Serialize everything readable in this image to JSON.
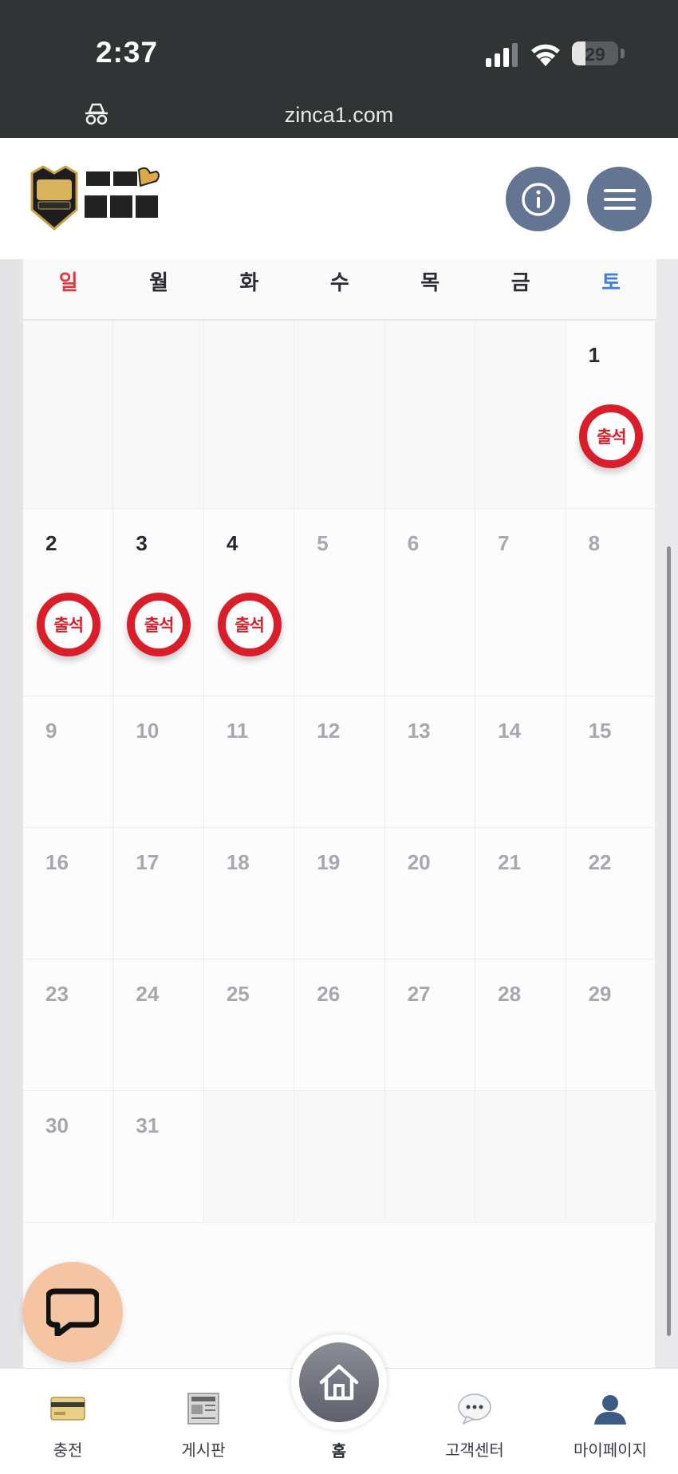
{
  "status_bar": {
    "time": "2:37",
    "battery": "29",
    "battery_level": 0.29
  },
  "browser": {
    "url": "zinca1.com"
  },
  "header": {
    "info_icon": "info-icon",
    "menu_icon": "hamburger-menu-icon",
    "logo_icon": "casino-logo"
  },
  "calendar": {
    "weekdays": [
      "일",
      "월",
      "화",
      "수",
      "목",
      "금",
      "토"
    ],
    "days": [
      "1",
      "2",
      "3",
      "4",
      "5",
      "6",
      "7",
      "8",
      "9",
      "10",
      "11",
      "12",
      "13",
      "14",
      "15",
      "16",
      "17",
      "18",
      "19",
      "20",
      "21",
      "22",
      "23",
      "24",
      "25",
      "26",
      "27",
      "28",
      "29",
      "30",
      "31"
    ],
    "attended": [
      "1",
      "2",
      "3",
      "4"
    ],
    "stamp_label": "출석",
    "first_weekday_index": 6,
    "colors": {
      "sunday": "#e3353d",
      "saturday": "#3f7de0",
      "stamp": "#d91e2a"
    }
  },
  "chat_button": {
    "icon": "chat-bubble-icon"
  },
  "bottom_nav": {
    "items": [
      {
        "label": "충전",
        "icon": "credit-card-icon"
      },
      {
        "label": "게시판",
        "icon": "newspaper-icon"
      },
      {
        "label": "홈",
        "icon": "home-icon"
      },
      {
        "label": "고객센터",
        "icon": "speech-bubble-icon"
      },
      {
        "label": "마이페이지",
        "icon": "user-icon"
      }
    ]
  }
}
